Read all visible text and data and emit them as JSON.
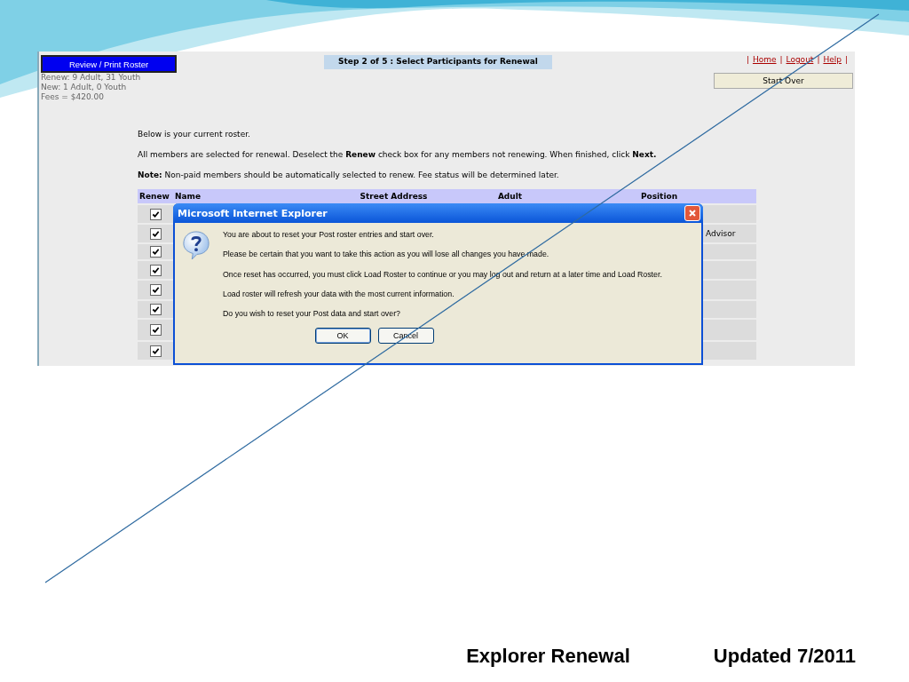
{
  "screenshot": {
    "review_button": "Review / Print Roster",
    "stats": [
      "Renew: 9 Adult, 31 Youth",
      "New: 1 Adult, 0 Youth",
      "Fees = $420.00"
    ],
    "step_title": "Step 2 of 5 : Select Participants for Renewal",
    "nav": [
      {
        "kind": "separator",
        "text": "|"
      },
      {
        "kind": "link",
        "text": "Home"
      },
      {
        "kind": "separator",
        "text": "|"
      },
      {
        "kind": "link",
        "text": "Logout"
      },
      {
        "kind": "separator",
        "text": "|"
      },
      {
        "kind": "link",
        "text": "Help"
      },
      {
        "kind": "separator",
        "text": "|"
      }
    ],
    "start_over_button": "Start Over",
    "instructions": [
      "Below is your current roster.",
      "All members are selected for renewal. Deselect the **Renew** check box for any members not renewing. When finished, click **Next.**",
      "**Note:** Non-paid members should be automatically selected to renew. Fee status will be determined later."
    ],
    "table": {
      "columns": [
        "Renew",
        "Name",
        "Street Address",
        "Adult",
        "Position"
      ],
      "rows": [
        {
          "renew": true
        },
        {
          "renew": true,
          "position": "Advisor"
        },
        {
          "renew": true
        },
        {
          "renew": true
        },
        {
          "renew": true
        },
        {
          "renew": true
        },
        {
          "renew": true
        },
        {
          "renew": true
        }
      ]
    },
    "dialog": {
      "title": "Microsoft Internet Explorer",
      "lines": [
        "You are about to reset your Post roster entries and start over.",
        "Please be certain that you want to take this action as you will lose all changes you have made.",
        "Once reset has occurred, you must click Load Roster to continue or you may log out and return at a later time and Load Roster.",
        "Load roster will refresh your data with the most current information.",
        "Do you wish to reset your Post data and start over?"
      ],
      "buttons": [
        "OK",
        "Cancel"
      ]
    }
  },
  "footer": {
    "title": "Explorer Renewal",
    "updated": "Updated 7/2011"
  }
}
